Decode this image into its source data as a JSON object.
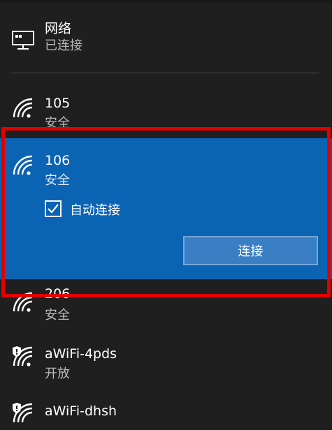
{
  "wired": {
    "title": "网络",
    "status": "已连接",
    "icon": "desktop-ethernet-icon"
  },
  "wifi_networks": [
    {
      "name": "105",
      "status": "安全",
      "icon": "wifi-secure-icon"
    },
    {
      "name": "106",
      "status": "安全",
      "icon": "wifi-secure-icon",
      "selected": true,
      "auto_connect_label": "自动连接",
      "auto_connect_checked": true,
      "connect_button_label": "连接"
    },
    {
      "name": "206",
      "status": "安全",
      "icon": "wifi-secure-icon"
    },
    {
      "name": "aWiFi-4pds",
      "status": "开放",
      "icon": "wifi-open-shield-icon"
    },
    {
      "name": "aWiFi-dhsh",
      "status": "",
      "icon": "wifi-open-shield-icon"
    }
  ],
  "colors": {
    "panel_bg": "#1f1f1f",
    "selected_bg": "#0b63b3",
    "button_bg": "#3a7fc4",
    "highlight_border": "#e30000",
    "secondary_text": "#b9b9b9"
  }
}
